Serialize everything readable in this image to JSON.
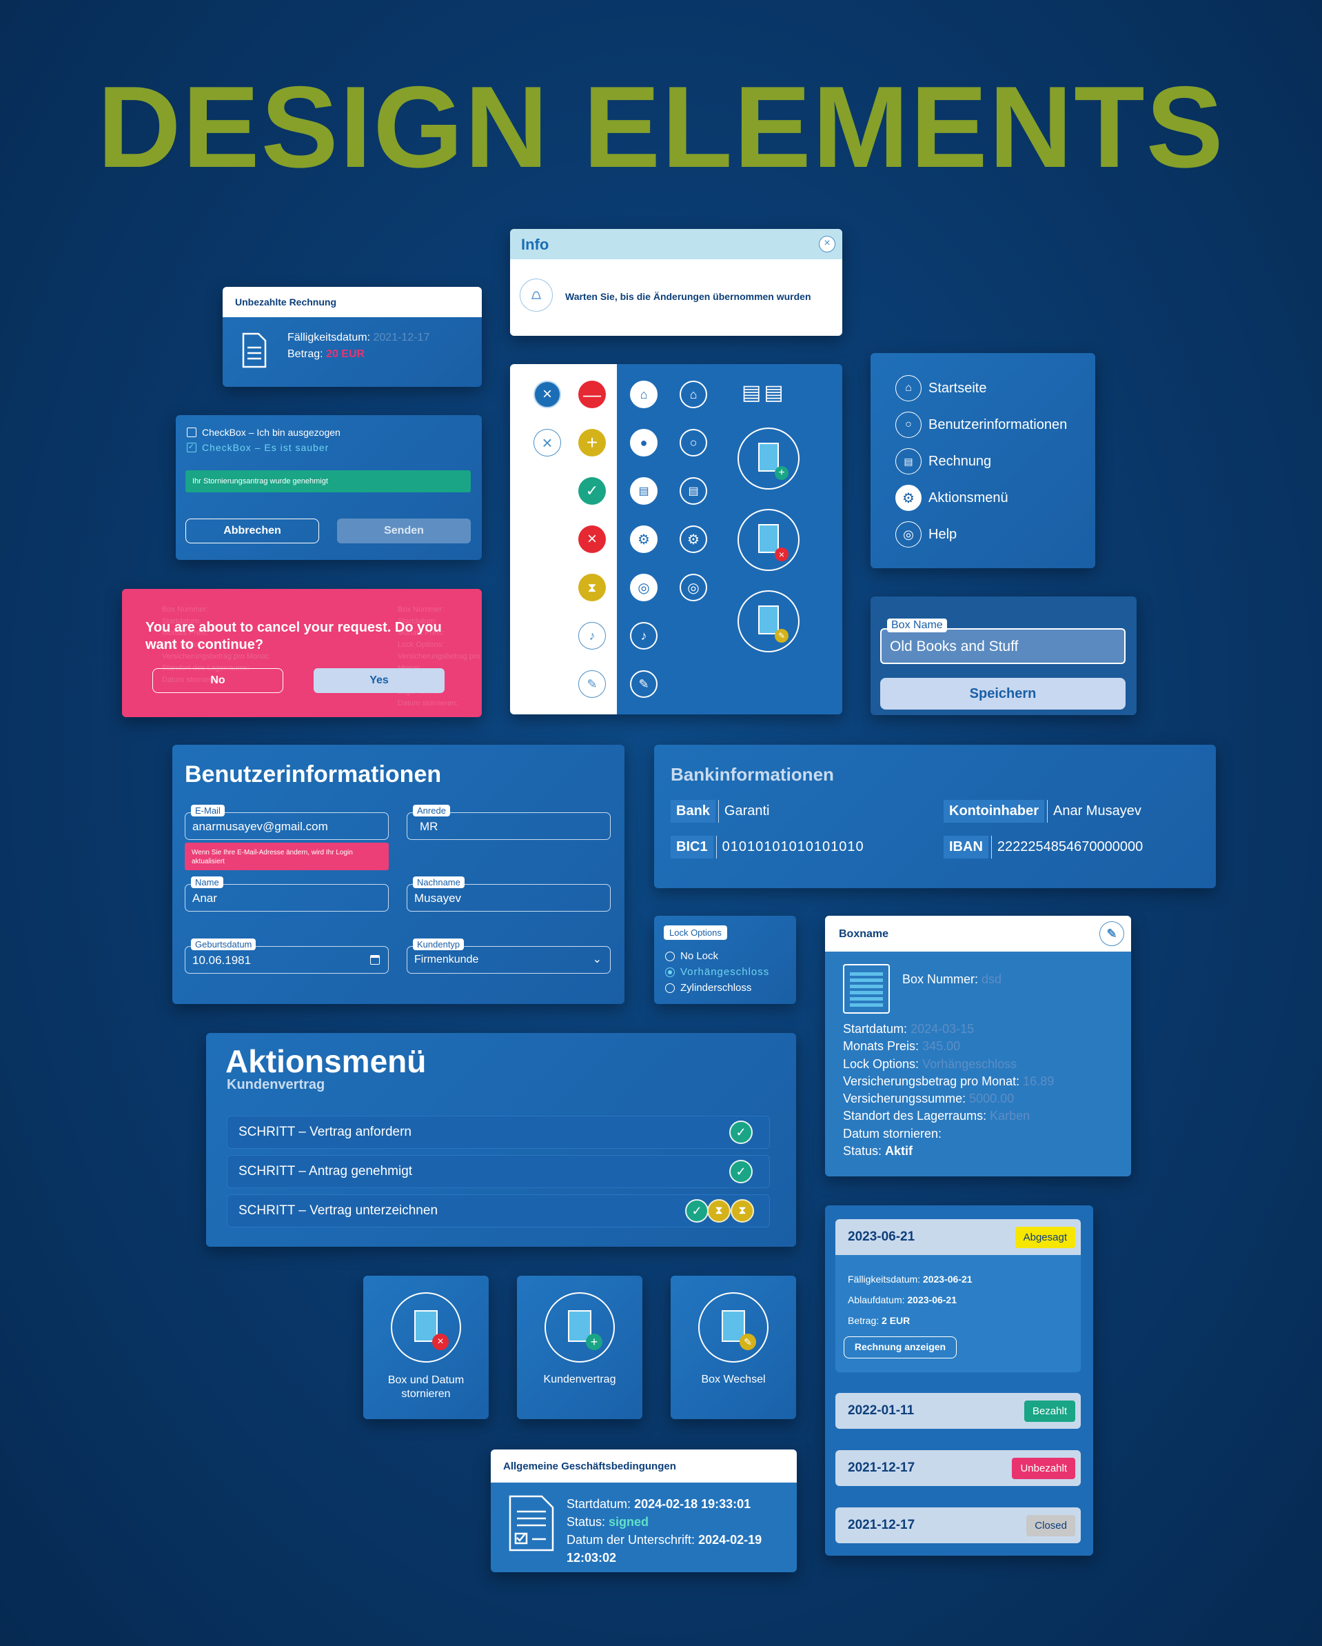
{
  "title": "DESIGN ELEMENTS",
  "colors": {
    "accent_green": "#86a02a",
    "card_blue": "#1a5fa6",
    "pink": "#e8336f",
    "success": "#19a586",
    "warning": "#d4b21a",
    "danger": "#e62833"
  },
  "unpaid_invoice": {
    "title": "Unbezahlte Rechnung",
    "due_label": "Fälligkeitsdatum:",
    "due_value": "2021-12-17",
    "amount_label": "Betrag:",
    "amount_value": "20 EUR"
  },
  "info_dialog": {
    "title": "Info",
    "message": "Warten Sie, bis die Änderungen übernommen wurden"
  },
  "checkbox_panel": {
    "checkbox1": "CheckBox – Ich bin ausgezogen",
    "checkbox2": "CheckBox – Es ist sauber",
    "success_message": "Ihr Stornierungsantrag wurde genehmigt",
    "cancel_button": "Abbrechen",
    "send_button": "Senden"
  },
  "confirm_dialog": {
    "message": "You are about to cancel your request. Do you want to continue?",
    "no_button": "No",
    "yes_button": "Yes",
    "bg_text": [
      "Box Nummer:",
      "Startdatum:",
      "Monats Preis:",
      "Lock Options:",
      "Versicherungsbetrag pro Monat:",
      "Standort des Lagerraums:",
      "Datum stornieren:"
    ]
  },
  "side_menu": {
    "items": [
      "Startseite",
      "Benutzerinformationen",
      "Rechnung",
      "Aktionsmenü",
      "Help"
    ]
  },
  "box_name_form": {
    "label": "Box Name",
    "value": "Old Books and Stuff",
    "save_button": "Speichern"
  },
  "user_info": {
    "title": "Benutzerinformationen",
    "email_label": "E-Mail",
    "email_value": "anarmusayev@gmail.com",
    "email_warning": "Wenn Sie Ihre E-Mail-Adresse ändern, wird Ihr Login aktualisiert",
    "salutation_label": "Anrede",
    "salutation_value": "MR",
    "name_label": "Name",
    "name_value": "Anar",
    "lastname_label": "Nachname",
    "lastname_value": "Musayev",
    "birthdate_label": "Geburtsdatum",
    "birthdate_value": "10.06.1981",
    "customer_type_label": "Kundentyp",
    "customer_type_value": "Firmenkunde"
  },
  "bank_info": {
    "title": "Bankinformationen",
    "bank_label": "Bank",
    "bank_value": "Garanti",
    "holder_label": "Kontoinhaber",
    "holder_value": "Anar Musayev",
    "bic_label": "BIC1",
    "bic_value": "01010101010101010",
    "iban_label": "IBAN",
    "iban_value": "2222254854670000000"
  },
  "lock_options": {
    "label": "Lock Options",
    "options": [
      "No Lock",
      "Vorhängeschloss",
      "Zylinderschloss"
    ],
    "selected": "Vorhängeschloss"
  },
  "box_details": {
    "title": "Boxname",
    "box_number_label": "Box Nummer:",
    "box_number_value": "dsd",
    "rows": [
      {
        "label": "Startdatum:",
        "value": "2024-03-15"
      },
      {
        "label": "Monats Preis:",
        "value": "345.00"
      },
      {
        "label": "Lock Options:",
        "value": "Vorhängeschloss"
      },
      {
        "label": "Versicherungsbetrag pro Monat:",
        "value": "16.89"
      },
      {
        "label": "Versicherungssumme:",
        "value": "5000.00"
      },
      {
        "label": "Standort des Lagerraums:",
        "value": "Karben"
      },
      {
        "label": "Datum stornieren:",
        "value": ""
      },
      {
        "label": "Status:",
        "value": "Aktif"
      }
    ]
  },
  "action_menu": {
    "title": "Aktionsmenü",
    "subtitle": "Kundenvertrag",
    "steps": [
      "SCHRITT – Vertrag anfordern",
      "SCHRITT – Antrag genehmigt",
      "SCHRITT – Vertrag unterzeichnen"
    ]
  },
  "tiles": [
    "Box und Datum stornieren",
    "Kundenvertrag",
    "Box Wechsel"
  ],
  "invoices": {
    "expanded": {
      "date": "2023-06-21",
      "status": "Abgesagt",
      "due_label": "Fälligkeitsdatum:",
      "due_value": "2023-06-21",
      "expiry_label": "Ablaufdatum:",
      "expiry_value": "2023-06-21",
      "amount_label": "Betrag:",
      "amount_value": "2 EUR",
      "button": "Rechnung anzeigen"
    },
    "rows": [
      {
        "date": "2022-01-11",
        "status": "Bezahlt",
        "color": "#19a586"
      },
      {
        "date": "2021-12-17",
        "status": "Unbezahlt",
        "color": "#e8336f"
      },
      {
        "date": "2021-12-17",
        "status": "Closed",
        "color": "#c8c8c8"
      }
    ]
  },
  "terms": {
    "title": "Allgemeine Geschäftsbedingungen",
    "start_label": "Startdatum:",
    "start_value": "2024-02-18 19:33:01",
    "status_label": "Status:",
    "status_value": "signed",
    "signed_label": "Datum der Unterschrift:",
    "signed_value": "2024-02-19 12:03:02"
  }
}
